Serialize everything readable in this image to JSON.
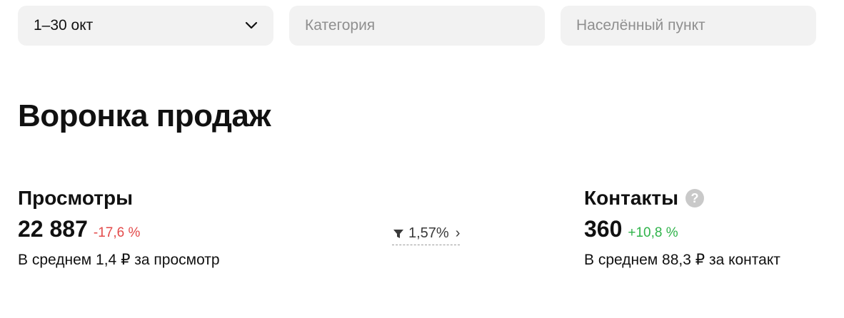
{
  "filters": {
    "period": "1–30 окт",
    "category_placeholder": "Категория",
    "locality_placeholder": "Населённый пункт"
  },
  "page_title": "Воронка продаж",
  "views": {
    "heading": "Просмотры",
    "value": "22 887",
    "delta": "-17,6 %",
    "avg": "В среднем 1,4 ₽ за просмотр"
  },
  "conversion": {
    "value": "1,57%",
    "arrow": "›",
    "icon": "funnel-icon"
  },
  "contacts": {
    "heading": "Контакты",
    "help_icon": "?",
    "value": "360",
    "delta": "+10,8 %",
    "avg": "В среднем 88,3 ₽ за контакт"
  },
  "colors": {
    "negative": "#e34a4a",
    "positive": "#2fb34a",
    "filter_bg": "#f2f2f2"
  }
}
